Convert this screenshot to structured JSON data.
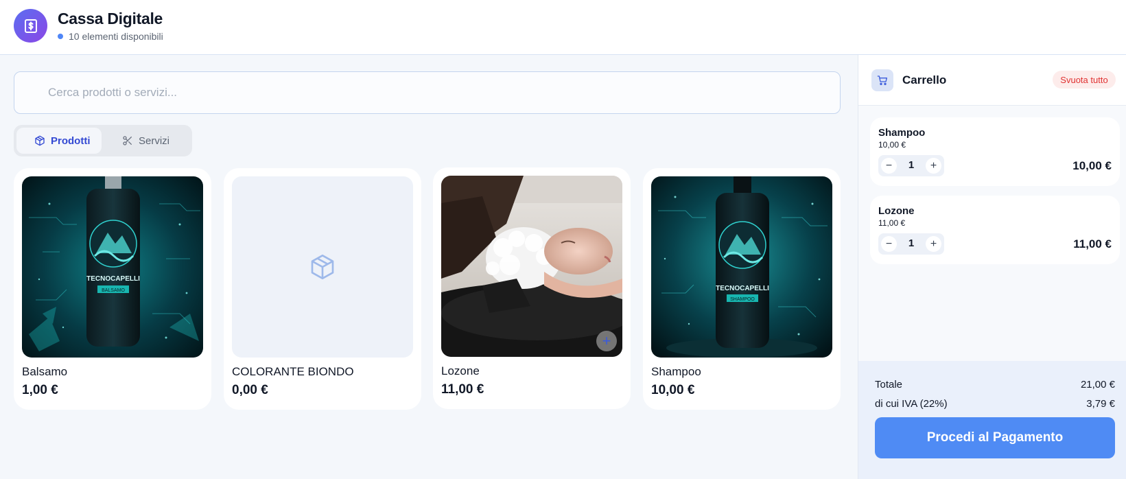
{
  "header": {
    "title": "Cassa Digitale",
    "subtitle": "10 elementi disponibili",
    "logo_icon": "cash-register-dollar-icon"
  },
  "search": {
    "placeholder": "Cerca prodotti o servizi...",
    "value": ""
  },
  "tabs": [
    {
      "label": "Prodotti",
      "icon": "box-icon",
      "active": true
    },
    {
      "label": "Servizi",
      "icon": "scissors-icon",
      "active": false
    }
  ],
  "products": [
    {
      "name": "Balsamo",
      "price": "1,00 €",
      "image": "balsamo-bottle",
      "bottle_brand": "TECNOCAPELLI",
      "bottle_label": "BALSAMO"
    },
    {
      "name": "COLORANTE BIONDO",
      "price": "0,00 €",
      "image": "placeholder-box"
    },
    {
      "name": "Lozone",
      "price": "11,00 €",
      "image": "hair-wash-photo"
    },
    {
      "name": "Shampoo",
      "price": "10,00 €",
      "image": "shampoo-bottle",
      "bottle_brand": "TECNOCAPELLI",
      "bottle_label": "SHAMPOO"
    }
  ],
  "cart": {
    "title": "Carrello",
    "clear_label": "Svuota tutto",
    "items": [
      {
        "name": "Shampoo",
        "unit_price": "10,00 €",
        "qty": "1",
        "total": "10,00 €"
      },
      {
        "name": "Lozone",
        "unit_price": "11,00 €",
        "qty": "1",
        "total": "11,00 €"
      }
    ],
    "total_label": "Totale",
    "total_value": "21,00 €",
    "vat_label": "di cui IVA (22%)",
    "vat_value": "3,79 €",
    "pay_label": "Procedi al Pagamento"
  },
  "colors": {
    "accent": "#4f8bf4",
    "active_tab_text": "#3349d3",
    "danger": "#e03131",
    "logo_gradient_start": "#5b6ef0",
    "logo_gradient_end": "#8b47e6"
  }
}
